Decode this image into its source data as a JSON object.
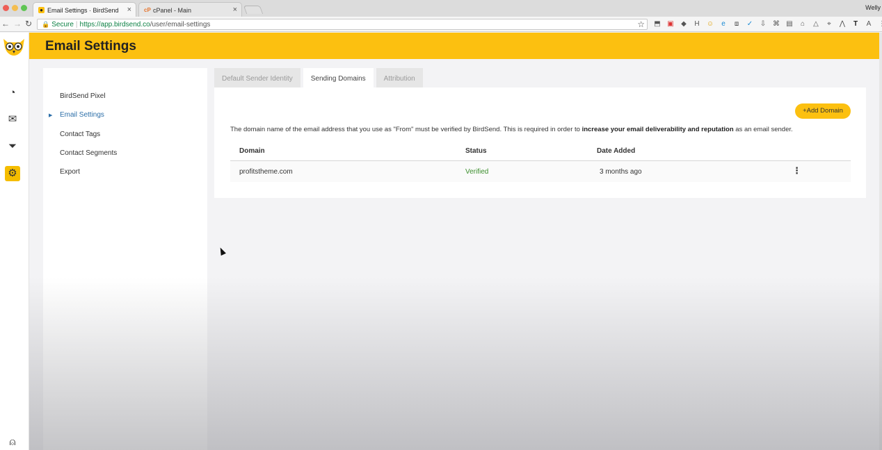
{
  "browser": {
    "tabs": [
      {
        "title": "Email Settings · BirdSend",
        "active": true
      },
      {
        "title": "cPanel - Main",
        "active": false
      }
    ],
    "user": "Welly",
    "secure_label": "Secure",
    "url_host": "https://app.birdsend.co",
    "url_path": "/user/email-settings"
  },
  "header": {
    "title": "Email Settings"
  },
  "subnav": {
    "items": [
      {
        "label": "BirdSend Pixel"
      },
      {
        "label": "Email Settings"
      },
      {
        "label": "Contact Tags"
      },
      {
        "label": "Contact Segments"
      },
      {
        "label": "Export"
      }
    ],
    "active_index": 1
  },
  "tabs": [
    {
      "label": "Default Sender Identity"
    },
    {
      "label": "Sending Domains"
    },
    {
      "label": "Attribution"
    }
  ],
  "active_tab": 1,
  "domains": {
    "add_button": "Add Domain",
    "description_prefix": "The domain name of the email address that you use as \"From\" must be verified by BirdSend. This is required in order to",
    "description_bold": "increase your email deliverability and reputation",
    "description_suffix": "as an email sender.",
    "columns": [
      "Domain",
      "Status",
      "Date Added"
    ],
    "rows": [
      {
        "domain": "profitstheme.com",
        "status": "Verified",
        "date_added": "3 months ago"
      }
    ]
  },
  "colors": {
    "brand_yellow": "#fcc010",
    "link_blue": "#2b6ea8",
    "verified_green": "#3b8e2c"
  }
}
